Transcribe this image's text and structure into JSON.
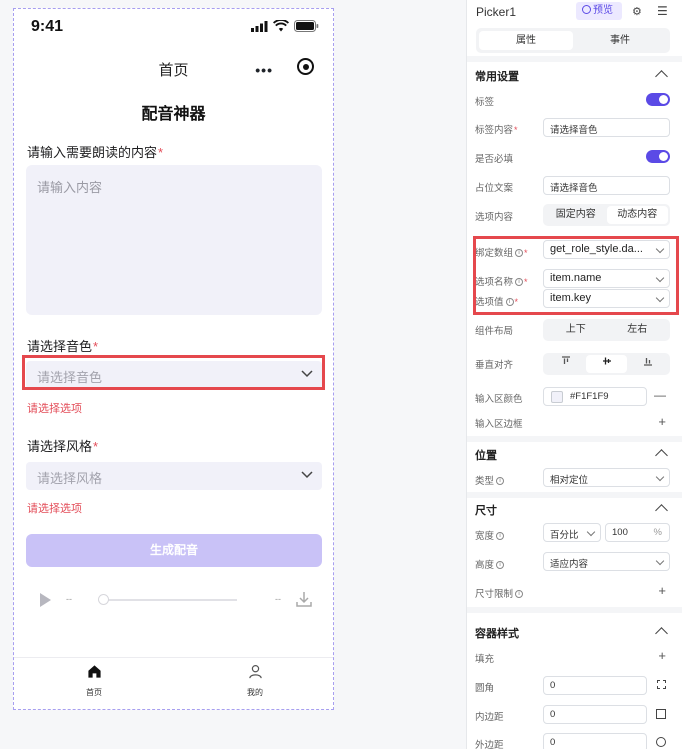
{
  "phone": {
    "status_time": "9:41",
    "nav_title": "首页",
    "nav_more": "•••",
    "page_title": "配音神器",
    "content_field": {
      "label": "请输入需要朗读的内容",
      "required_mark": "*",
      "placeholder": "请输入内容"
    },
    "voice_field": {
      "label": "请选择音色",
      "required_mark": "*",
      "placeholder": "请选择音色",
      "error": "请选择选项"
    },
    "style_field": {
      "label": "请选择风格",
      "required_mark": "*",
      "placeholder": "请选择风格",
      "error": "请选择选项"
    },
    "submit_label": "生成配音",
    "audio": {
      "current_time": "--",
      "duration": "--",
      "progress": 0
    },
    "tabs": [
      {
        "label": "首页",
        "icon": "home-icon"
      },
      {
        "label": "我的",
        "icon": "user-icon"
      }
    ]
  },
  "panel": {
    "component_name": "Picker1",
    "preview_label": "预览",
    "tabs": [
      "属性",
      "事件"
    ],
    "common": {
      "title": "常用设置",
      "label_toggle": "标签",
      "label_content_label": "标签内容",
      "label_content_value": "请选择音色",
      "required_label": "是否必填",
      "placeholder_label": "占位文案",
      "placeholder_value": "请选择音色",
      "options_label": "选项内容",
      "options_modes": [
        "固定内容",
        "动态内容"
      ],
      "bind_array_label": "绑定数组",
      "bind_array_value": "get_role_style.da...",
      "option_name_label": "选项名称",
      "option_name_value": "item.name",
      "option_value_label": "选项值",
      "option_value_value": "item.key",
      "layout_label": "组件布局",
      "layout_modes": [
        "上下",
        "左右"
      ],
      "valign_label": "垂直对齐",
      "input_bg_label": "输入区颜色",
      "input_bg_value": "#F1F1F9",
      "input_border_label": "输入区边框"
    },
    "position": {
      "title": "位置",
      "type_label": "类型",
      "type_value": "相对定位"
    },
    "size": {
      "title": "尺寸",
      "width_label": "宽度",
      "width_unit": "百分比",
      "width_value": "100",
      "width_suffix": "%",
      "height_label": "高度",
      "height_value": "适应内容",
      "limit_label": "尺寸限制"
    },
    "container": {
      "title": "容器样式",
      "fill_label": "填充",
      "radius_label": "圆角",
      "radius_value": "0",
      "padding_label": "内边距",
      "padding_value": "0",
      "margin_label": "外边距",
      "margin_value": "0"
    }
  },
  "colors": {
    "accent": "#5b4ae6",
    "error": "#e34d59",
    "input_bg": "#F1F1F9"
  }
}
